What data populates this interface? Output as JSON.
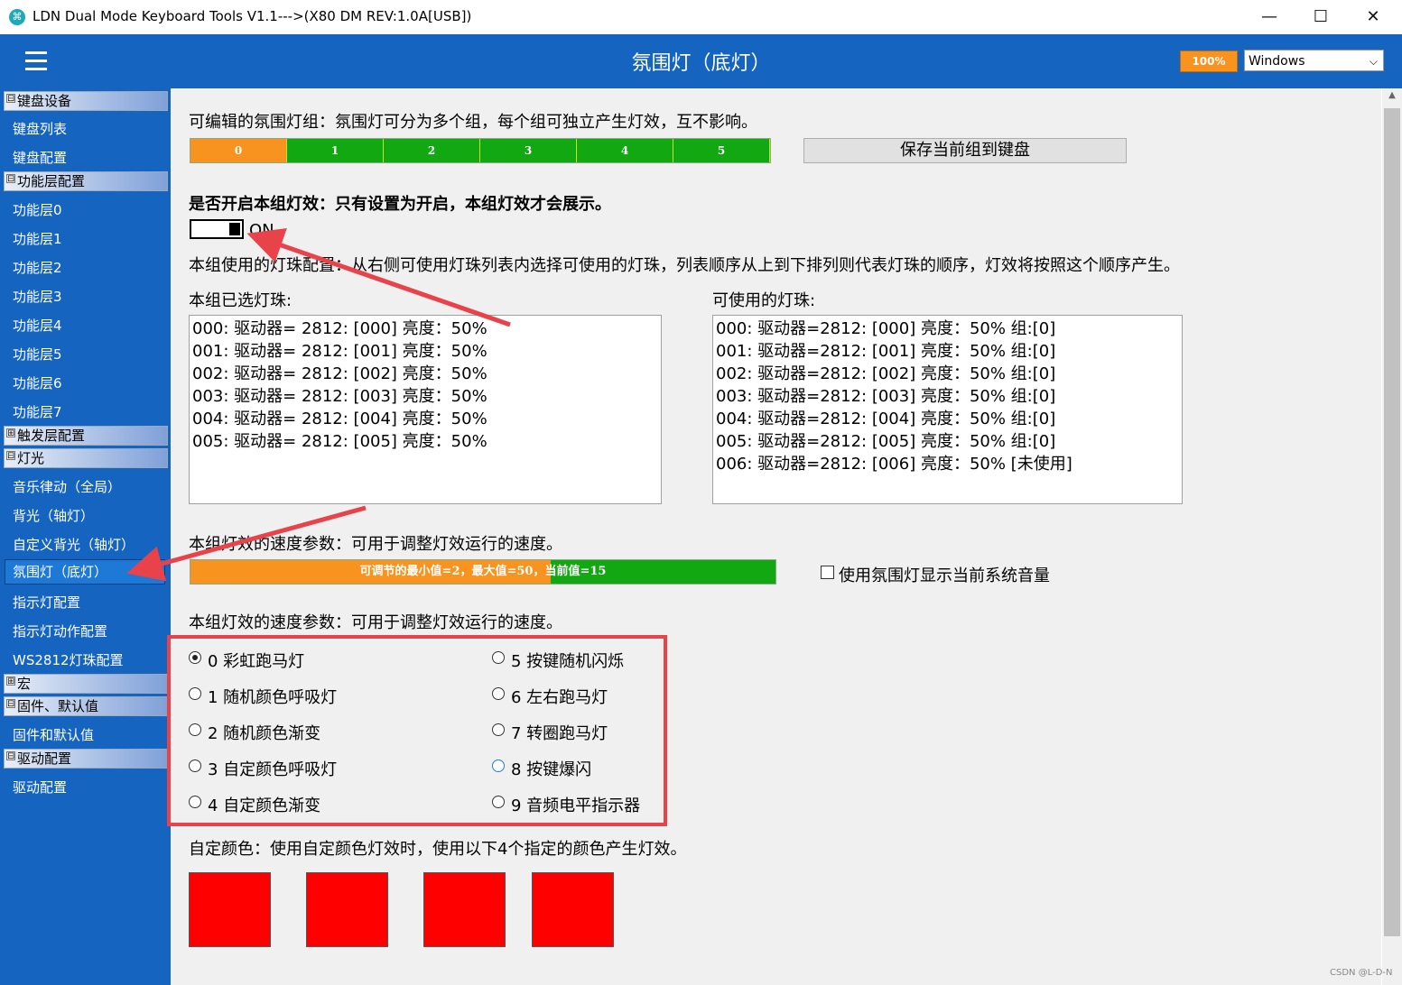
{
  "window": {
    "title": "LDN Dual Mode Keyboard Tools V1.1--->(X80 DM REV:1.0A[USB])",
    "minimize": "—",
    "maximize": "☐",
    "close": "✕"
  },
  "header": {
    "title": "氛围灯（底灯）",
    "zoom": "100%",
    "os_selected": "Windows"
  },
  "sidebar": {
    "groups": [
      {
        "label": "键盘设备",
        "expander": "⊟"
      },
      {
        "label": "功能层配置",
        "expander": "⊟"
      },
      {
        "label": "触发层配置",
        "expander": "⊞"
      },
      {
        "label": "灯光",
        "expander": "⊟"
      },
      {
        "label": "宏",
        "expander": "⊞"
      },
      {
        "label": "固件、默认值",
        "expander": "⊟"
      },
      {
        "label": "驱动配置",
        "expander": "⊟"
      }
    ],
    "items": [
      "键盘列表",
      "键盘配置",
      "功能层0",
      "功能层1",
      "功能层2",
      "功能层3",
      "功能层4",
      "功能层5",
      "功能层6",
      "功能层7",
      "音乐律动（全局）",
      "背光（轴灯）",
      "自定义背光（轴灯）",
      "氛围灯（底灯）",
      "指示灯配置",
      "指示灯动作配置",
      "WS2812灯珠配置",
      "固件和默认值",
      "驱动配置"
    ]
  },
  "main": {
    "group_desc": "可编辑的氛围灯组：氛围灯可分为多个组，每个组可独立产生灯效，互不影响。",
    "groups": [
      "0",
      "1",
      "2",
      "3",
      "4",
      "5"
    ],
    "active_group": "0",
    "save_button": "保存当前组到键盘",
    "enable_desc": "是否开启本组灯效：只有设置为开启，本组灯效才会展示。",
    "toggle_state": "ON",
    "led_config_desc": "本组使用的灯珠配置：从右侧可使用灯珠列表内选择可使用的灯珠，列表顺序从上到下排列则代表灯珠的顺序，灯效将按照这个顺序产生。",
    "selected_label": "本组已选灯珠:",
    "available_label": "可使用的灯珠:",
    "selected_leds": [
      "000: 驱动器= 2812: [000] 亮度：50%",
      "001: 驱动器= 2812: [001] 亮度：50%",
      "002: 驱动器= 2812: [002] 亮度：50%",
      "003: 驱动器= 2812: [003] 亮度：50%",
      "004: 驱动器= 2812: [004] 亮度：50%",
      "005: 驱动器= 2812: [005] 亮度：50%"
    ],
    "available_leds": [
      "000: 驱动器=2812: [000] 亮度：50% 组:[0]",
      "001: 驱动器=2812: [001] 亮度：50% 组:[0]",
      "002: 驱动器=2812: [002] 亮度：50% 组:[0]",
      "003: 驱动器=2812: [003] 亮度：50% 组:[0]",
      "004: 驱动器=2812: [004] 亮度：50% 组:[0]",
      "005: 驱动器=2812: [005] 亮度：50% 组:[0]",
      "006: 驱动器=2812: [006] 亮度：50% [未使用]"
    ],
    "speed_desc": "本组灯效的速度参数：可用于调整灯效运行的速度。",
    "speed_label": "可调节的最小值=2，最大值=50，当前值=15",
    "speed": {
      "min": 2,
      "max": 50,
      "value": 15
    },
    "volume_checkbox": "使用氛围灯显示当前系统音量",
    "effect_desc": "本组灯效的速度参数：可用于调整灯效运行的速度。",
    "effects": [
      "0 彩虹跑马灯",
      "1 随机颜色呼吸灯",
      "2 随机颜色渐变",
      "3 自定颜色呼吸灯",
      "4 自定颜色渐变",
      "5 按键随机闪烁",
      "6 左右跑马灯",
      "7 转圈跑马灯",
      "8 按键爆闪",
      "9 音频电平指示器"
    ],
    "selected_effect": "0 彩虹跑马灯",
    "custom_color_desc": "自定颜色：使用自定颜色灯效时，使用以下4个指定的颜色产生灯效。",
    "custom_colors": [
      "#ff0000",
      "#ff0000",
      "#ff0000",
      "#ff0000"
    ]
  },
  "watermark": "CSDN @L-D-N",
  "colors": {
    "accent": "#1565c0",
    "active_orange": "#f7931e",
    "green": "#12a812",
    "annotation_red": "#e8424a"
  }
}
